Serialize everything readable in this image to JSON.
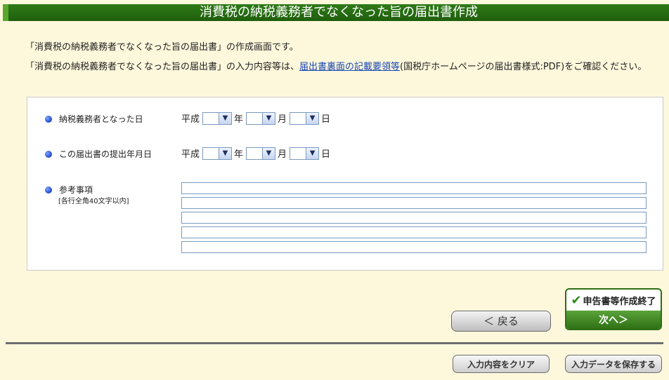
{
  "title": "消費税の納税義務者でなくなった旨の届出書作成",
  "intro": {
    "line1": "「消費税の納税義務者でなくなった旨の届出書」の作成画面です。",
    "line2_pre": "「消費税の納税義務者でなくなった旨の届出書」の入力内容等は、",
    "line2_link": "届出書裏面の記載要領等",
    "line2_post": "(国税庁ホームページの届出書様式:PDF)をご確認ください。"
  },
  "form": {
    "date1_label": "納税義務者となった日",
    "date2_label": "この届出書の提出年月日",
    "notes_label": "参考事項",
    "notes_sub": "[各行全角40文字以内]",
    "era": "平成",
    "year_unit": "年",
    "month_unit": "月",
    "day_unit": "日",
    "dropdown_arrow": "▼"
  },
  "buttons": {
    "back": "＜  戻る",
    "finish_top": "申告書等作成終了",
    "finish_check": "✔",
    "next": "次へ＞",
    "clear": "入力内容をクリア",
    "save": "入力データを保存する"
  }
}
